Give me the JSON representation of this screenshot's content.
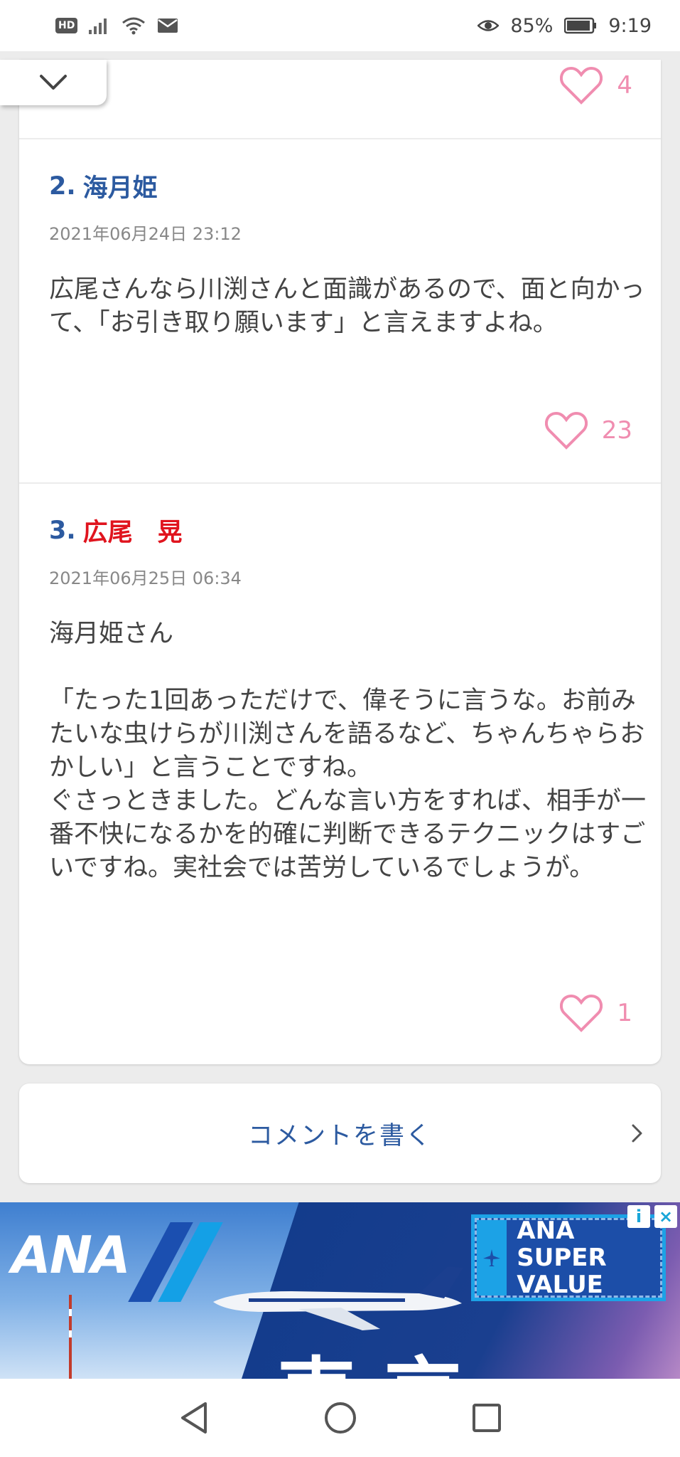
{
  "status_bar": {
    "hd": "HD",
    "battery": "85%",
    "time": "9:19"
  },
  "top_like_count": "4",
  "comments": [
    {
      "number": "2.",
      "author": "海月姫",
      "date": "2021年06月24日 23:12",
      "body": "広尾さんなら川渕さんと面識があるので、面と向かって、「お引き取り願います」と言えますよね。",
      "likes": "23"
    },
    {
      "number": "3.",
      "author": "広尾　晃",
      "date": "2021年06月25日 06:34",
      "body": "海月姫さん\n\n「たった1回あっただけで、偉そうに言うな。お前みたいな虫けらが川渕さんを語るなど、ちゃんちゃらおかしい」と言うことですね。\nぐさっときました。どんな言い方をすれば、相手が一番不快になるかを的確に判断できるテクニックはすごいですね。実社会では苦労しているでしょうが。",
      "likes": "1"
    }
  ],
  "write_comment_label": "コメントを書く",
  "ad": {
    "brand": "ANA",
    "badge_line1": "ANA SUPER",
    "badge_line2": "VALUE",
    "headline": "東京"
  },
  "colors": {
    "heart": "#f08db0",
    "link_blue": "#2c5aa0",
    "author_red": "#e0141e"
  }
}
